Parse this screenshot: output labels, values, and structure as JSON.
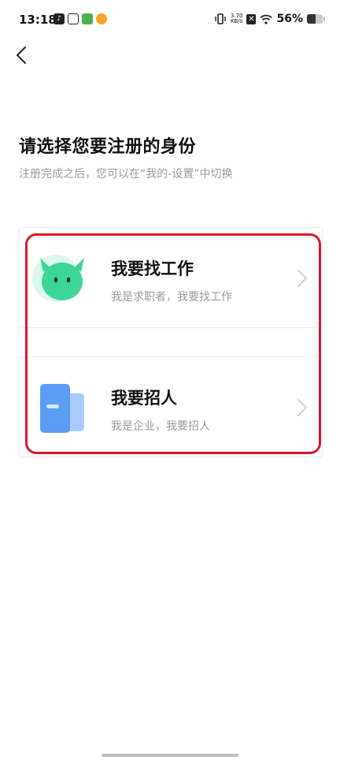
{
  "status_bar": {
    "time": "13:18",
    "net_speed_value": "3.70",
    "net_speed_unit": "KB/s",
    "battery_percent": "56%",
    "battery_level": 0.56,
    "apps": [
      "tiktok-icon",
      "link-app-icon",
      "game-app-icon",
      "weibo-icon"
    ]
  },
  "header": {
    "back_icon": "chevron-left-icon"
  },
  "main": {
    "title": "请选择您要注册的身份",
    "subtitle": "注册完成之后，您可以在“我的-设置”中切换"
  },
  "options": [
    {
      "title": "我要找工作",
      "description": "我是求职者，我要找工作",
      "icon": "job-seeker-icon",
      "accent": "#3ed598"
    },
    {
      "title": "我要招人",
      "description": "我是企业，我要招人",
      "icon": "employer-icon",
      "accent": "#5b9cf5"
    }
  ],
  "colors": {
    "annotation": "#d61b2a",
    "muted_text": "#9a9a9a"
  }
}
